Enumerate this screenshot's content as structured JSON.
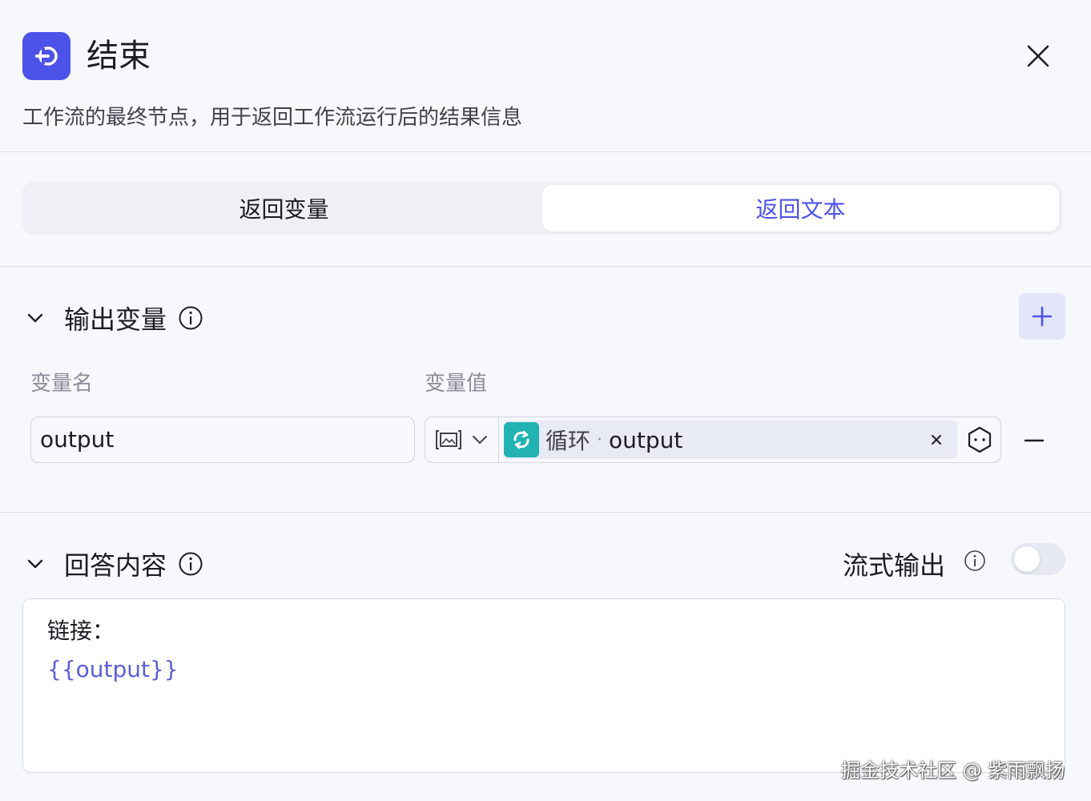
{
  "header": {
    "title": "结束",
    "description": "工作流的最终节点，用于返回工作流运行后的结果信息"
  },
  "tabs": [
    {
      "label": "返回变量",
      "active": false
    },
    {
      "label": "返回文本",
      "active": true
    }
  ],
  "output_section": {
    "title": "输出变量",
    "columns": {
      "name": "变量名",
      "value": "变量值"
    },
    "row": {
      "name": "output",
      "ref_node": "循环",
      "ref_separator": "·",
      "ref_variable": "output"
    }
  },
  "answer_section": {
    "title": "回答内容",
    "stream_label": "流式输出",
    "stream_enabled": false,
    "content_line1": "链接：",
    "content_line2": "{{output}}"
  },
  "watermark": "掘金技术社区 @ 紫雨飘扬",
  "colors": {
    "accent": "#4d53e8",
    "loop_icon": "#20b3b2",
    "background": "#f7f8fc"
  },
  "icons": [
    "end-node-icon",
    "close-icon",
    "chevron-down-icon",
    "info-icon",
    "plus-icon",
    "image-type-icon",
    "loop-icon",
    "clear-icon",
    "variable-picker-icon",
    "minus-icon"
  ]
}
